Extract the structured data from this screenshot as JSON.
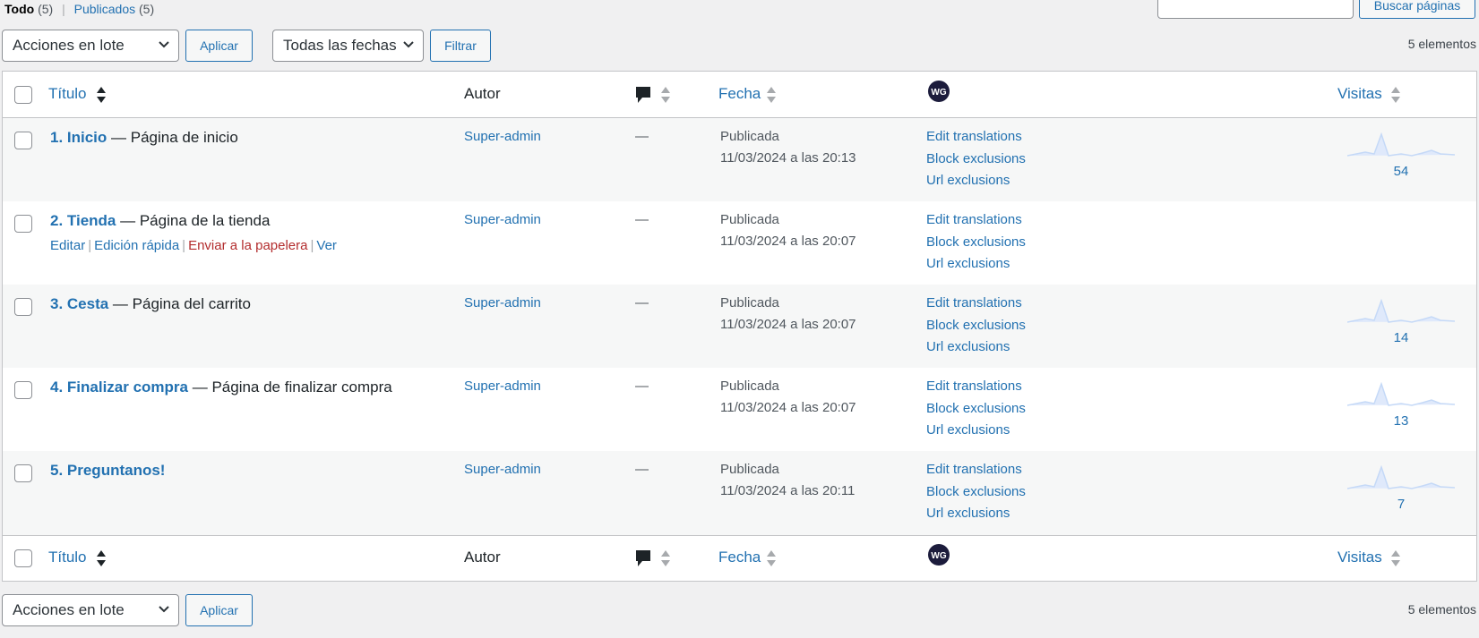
{
  "filters": {
    "all_label": "Todo",
    "all_count": "(5)",
    "separator": "|",
    "published_label": "Publicados",
    "published_count": "(5)"
  },
  "search": {
    "placeholder": "",
    "button_label": "Buscar páginas"
  },
  "tablenav_top": {
    "bulk_select": "Acciones en lote",
    "apply_label": "Aplicar",
    "date_select": "Todas las fechas",
    "filter_label": "Filtrar",
    "items_count": "5 elementos"
  },
  "tablenav_bottom": {
    "bulk_select": "Acciones en lote",
    "apply_label": "Aplicar",
    "items_count": "5 elementos"
  },
  "columns": {
    "title": "Título",
    "author": "Autor",
    "date": "Fecha",
    "visits": "Visitas",
    "wg_logo_text": "WG"
  },
  "rows": [
    {
      "title": "1. Inicio",
      "state": " — Página de inicio",
      "author": "Super-admin",
      "comments": "—",
      "status": "Publicada",
      "date": "11/03/2024 a las 20:13",
      "wg": [
        "Edit translations",
        "Block exclusions",
        "Url exclusions"
      ],
      "visits": "54"
    },
    {
      "title": "2. Tienda",
      "state": " — Página de la tienda",
      "author": "Super-admin",
      "comments": "—",
      "status": "Publicada",
      "date": "11/03/2024 a las 20:07",
      "wg": [
        "Edit translations",
        "Block exclusions",
        "Url exclusions"
      ],
      "visits": "",
      "actions": {
        "edit": "Editar",
        "quick_edit": "Edición rápida",
        "trash": "Enviar a la papelera",
        "view": "Ver",
        "sep": "|"
      }
    },
    {
      "title": "3. Cesta",
      "state": " — Página del carrito",
      "author": "Super-admin",
      "comments": "—",
      "status": "Publicada",
      "date": "11/03/2024 a las 20:07",
      "wg": [
        "Edit translations",
        "Block exclusions",
        "Url exclusions"
      ],
      "visits": "14"
    },
    {
      "title": "4. Finalizar compra",
      "state": " — Página de finalizar compra",
      "author": "Super-admin",
      "comments": "—",
      "status": "Publicada",
      "date": "11/03/2024 a las 20:07",
      "wg": [
        "Edit translations",
        "Block exclusions",
        "Url exclusions"
      ],
      "visits": "13"
    },
    {
      "title": "5. Preguntanos!",
      "state": "",
      "author": "Super-admin",
      "comments": "—",
      "status": "Publicada",
      "date": "11/03/2024 a las 20:11",
      "wg": [
        "Edit translations",
        "Block exclusions",
        "Url exclusions"
      ],
      "visits": "7"
    }
  ],
  "colors": {
    "link": "#2271b1",
    "trash": "#b32d2e",
    "background": "#f0f0f1",
    "row_alt": "#f6f7f7",
    "sparkline": "#c5d9f7",
    "wg_logo": "#1c1c3c"
  }
}
